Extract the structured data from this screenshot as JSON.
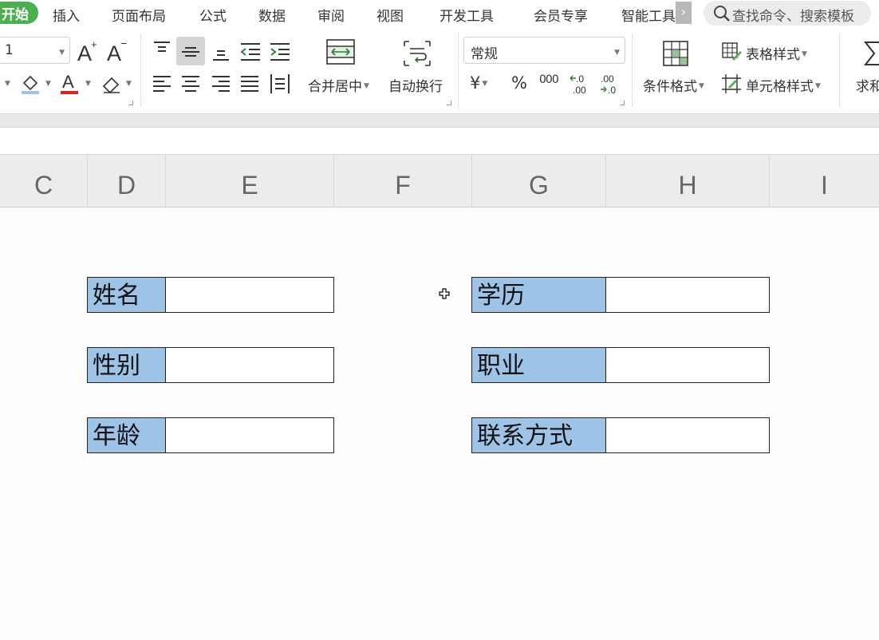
{
  "menu": {
    "tabs": [
      {
        "label": "开始",
        "active": true
      },
      {
        "label": "插入"
      },
      {
        "label": "页面布局"
      },
      {
        "label": "公式"
      },
      {
        "label": "数据"
      },
      {
        "label": "审阅"
      },
      {
        "label": "视图"
      },
      {
        "label": "开发工具"
      },
      {
        "label": "会员专享"
      },
      {
        "label": "智能工具"
      }
    ],
    "more_icon": "chevron-right-icon",
    "search_placeholder": "查找命令、搜索模板"
  },
  "ribbon": {
    "font_size_value": "1",
    "number_format_value": "常规",
    "merge_center_label": "合并居中",
    "wrap_text_label": "自动换行",
    "currency_symbol": "¥",
    "percent_symbol": "%",
    "thousands_symbol": "000",
    "conditional_format_label": "条件格式",
    "table_style_label": "表格样式",
    "cell_style_label": "单元格样式",
    "sum_label": "求和",
    "accent_color": "#4caf50",
    "font_color_bar": "#e02020",
    "fill_color_bar": "#9dc3e6"
  },
  "columns": [
    "C",
    "D",
    "E",
    "F",
    "G",
    "H",
    "I"
  ],
  "sheet": {
    "label_fill": "#9dc3e6",
    "fields_left": [
      {
        "label": "姓名",
        "value": ""
      },
      {
        "label": "性别",
        "value": ""
      },
      {
        "label": "年龄",
        "value": ""
      }
    ],
    "fields_right": [
      {
        "label": "学历",
        "value": ""
      },
      {
        "label": "职业",
        "value": ""
      },
      {
        "label": "联系方式",
        "value": ""
      }
    ]
  }
}
